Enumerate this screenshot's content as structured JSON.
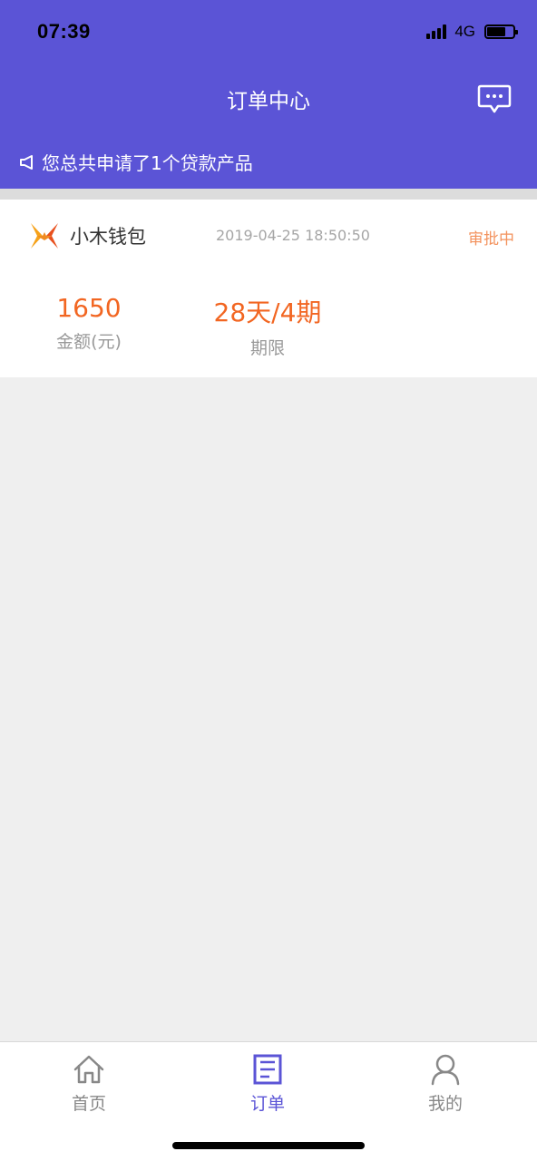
{
  "status_bar": {
    "time": "07:39",
    "network": "4G"
  },
  "header": {
    "title": "订单中心",
    "notice": "您总共申请了1个贷款产品"
  },
  "order": {
    "product_name": "小木钱包",
    "date": "2019-04-25 18:50:50",
    "status": "审批中",
    "amount_value": "1650",
    "amount_label": "金额(元)",
    "term_value": "28天/4期",
    "term_label": "期限"
  },
  "tabbar": {
    "home": "首页",
    "orders": "订单",
    "mine": "我的"
  },
  "colors": {
    "brand": "#5b54d6",
    "accent": "#f26622",
    "status": "#f3925d"
  }
}
